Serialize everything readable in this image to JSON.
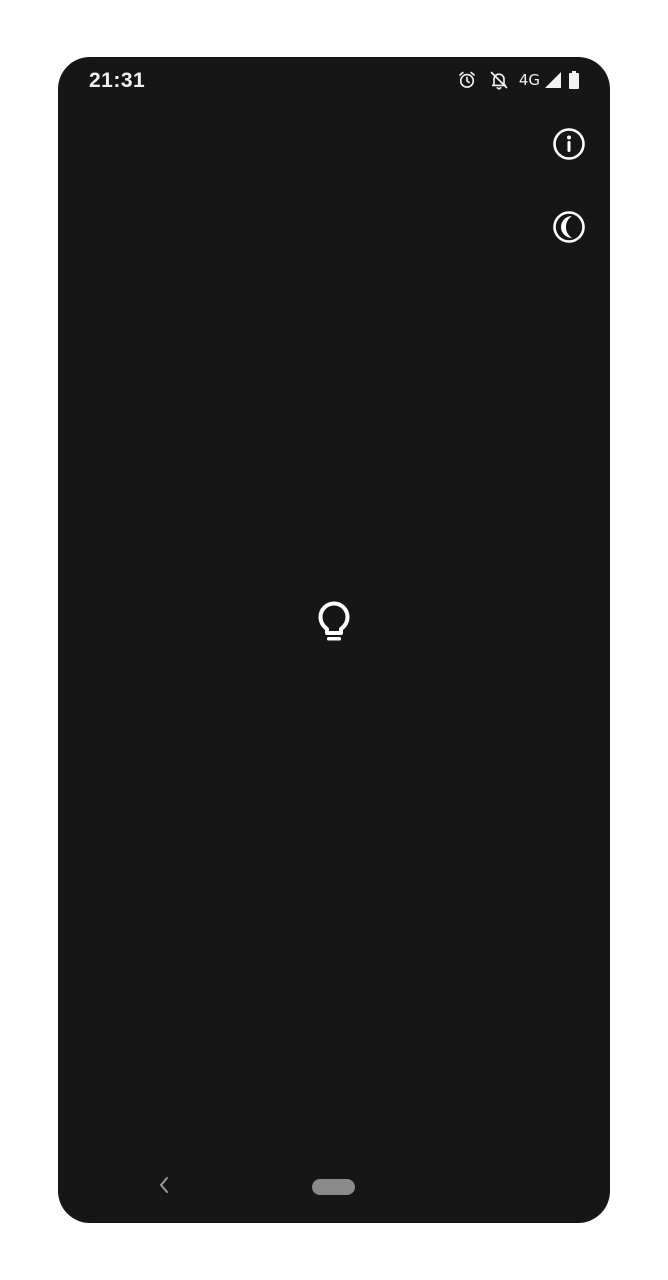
{
  "status_bar": {
    "time": "21:31",
    "network": "4G",
    "icons": [
      "alarm-icon",
      "notifications-off-icon",
      "cellular-signal-icon",
      "battery-icon"
    ]
  },
  "toolbar": {
    "info_icon": "info-icon",
    "theme_icon": "dark-mode-icon"
  },
  "main": {
    "center_icon": "lightbulb-icon"
  },
  "navigation": {
    "back_icon": "back-chevron-icon",
    "home_handle": "home-pill"
  },
  "colors": {
    "background": "#161616",
    "foreground": "#ffffff",
    "home_pill": "#8a8a8a"
  }
}
